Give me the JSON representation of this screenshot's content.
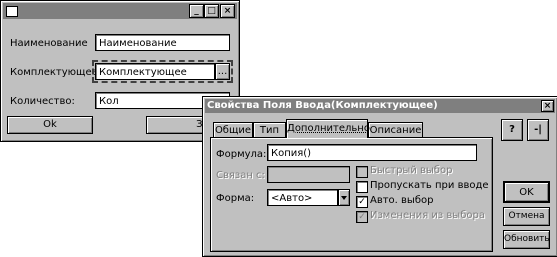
{
  "back_window": {
    "labels": {
      "name": "Наименование",
      "component": "Комплектующее",
      "quantity": "Количество:"
    },
    "values": {
      "name": "Наименование",
      "component": "Комплектующее",
      "quantity": "Кол"
    },
    "ellipsis": "...",
    "ok_label": "Ok",
    "close_label": "Закры"
  },
  "dialog": {
    "title": "Свойства Поля Ввода(Комплектующее)",
    "tabs": [
      "Общие",
      "Тип",
      "Дополнительно",
      "Описание"
    ],
    "active_tab": "Дополнительно",
    "formula_label": "Формула:",
    "formula_value": "Копия()",
    "linked_label": "Связан с:",
    "form_label": "Форма:",
    "form_value": "<Авто>",
    "checkboxes": [
      {
        "label": "Быстрый выбор",
        "checked": false,
        "disabled": true
      },
      {
        "label": "Пропускать при вводе",
        "checked": false,
        "disabled": false
      },
      {
        "label": "Авто. выбор",
        "checked": true,
        "disabled": false
      },
      {
        "label": "Изменения из выбора",
        "checked": true,
        "disabled": true
      }
    ],
    "buttons": {
      "ok": "OK",
      "cancel": "Отмена",
      "refresh": "Обновить"
    },
    "close_glyph": "×",
    "help_glyph": "?",
    "pin_glyph": "-|"
  }
}
